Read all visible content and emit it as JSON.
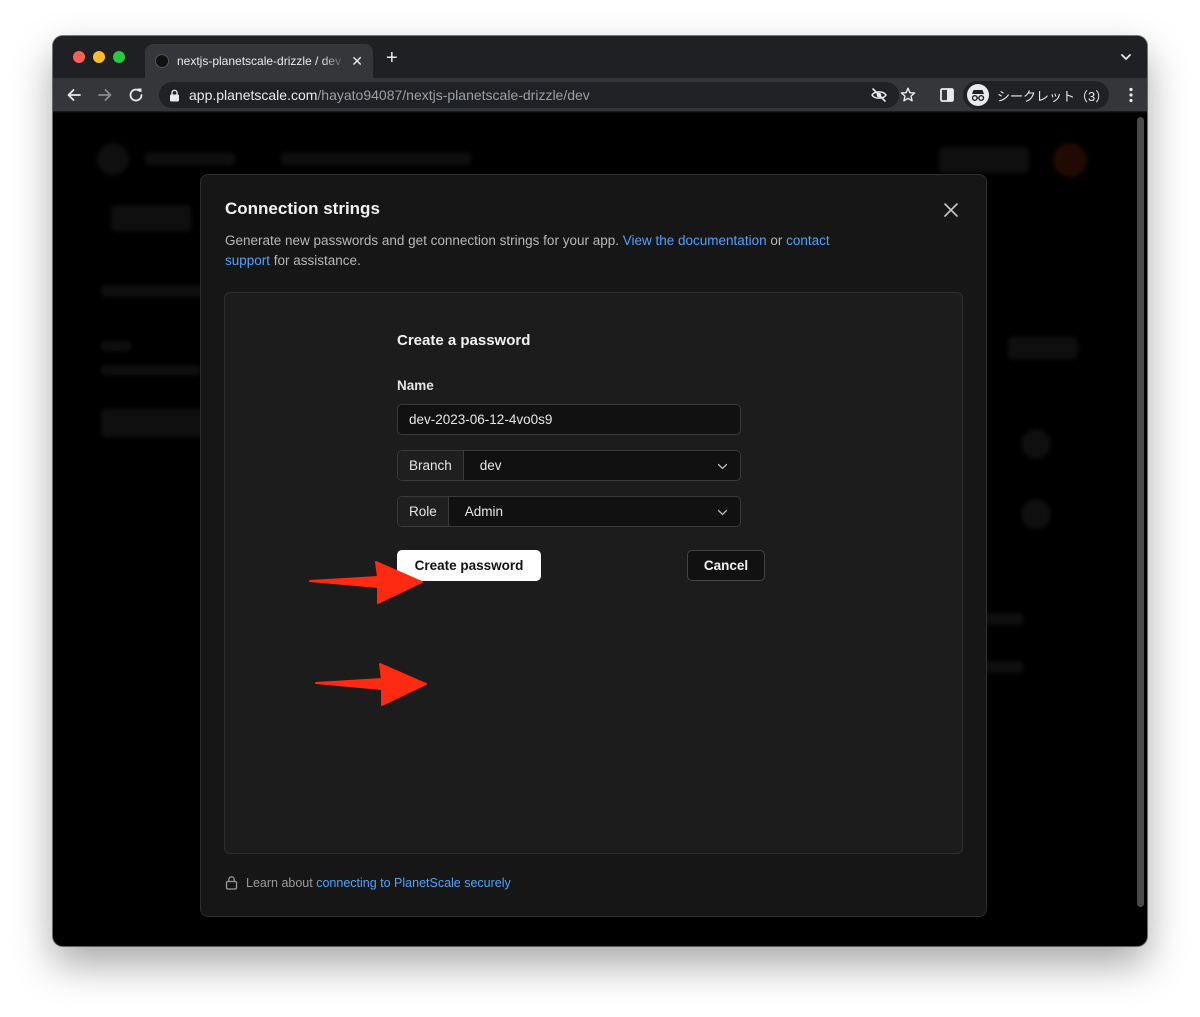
{
  "browser": {
    "tab_title": "nextjs-planetscale-drizzle / dev",
    "url_host": "app.planetscale.com",
    "url_path": "/hayato94087/nextjs-planetscale-drizzle/dev",
    "incognito_label": "シークレット（3）"
  },
  "modal": {
    "title": "Connection strings",
    "desc_prefix": "Generate new passwords and get connection strings for your app. ",
    "doc_link": "View the documentation",
    "desc_or": " or ",
    "contact_link_1": "contact",
    "contact_link_2": "support",
    "desc_suffix": " for assistance."
  },
  "form": {
    "title": "Create a password",
    "name_label": "Name",
    "name_value": "dev-2023-06-12-4vo0s9",
    "branch_label": "Branch",
    "branch_value": "dev",
    "role_label": "Role",
    "role_value": "Admin",
    "create_button": "Create password",
    "cancel_button": "Cancel"
  },
  "footer": {
    "prefix": "Learn about ",
    "link": "connecting to PlanetScale securely"
  },
  "colors": {
    "accent_link": "#4da3ff",
    "annotation_arrow": "#ff2a12"
  }
}
